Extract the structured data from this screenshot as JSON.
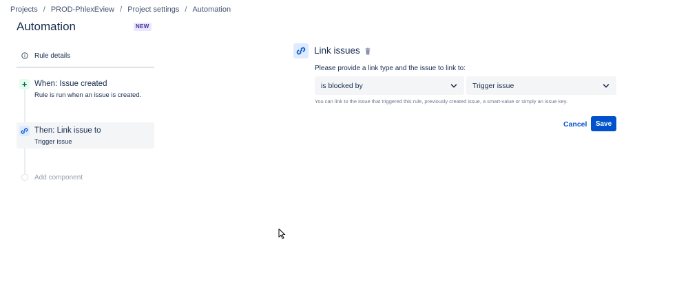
{
  "breadcrumb": {
    "items": [
      "Projects",
      "PROD-PhlexEview",
      "Project settings",
      "Automation"
    ],
    "separator": "/"
  },
  "page": {
    "title": "Automation",
    "badge": "NEW"
  },
  "rail": {
    "rule_details": {
      "label": "Rule details",
      "icon": "info-icon"
    },
    "steps": [
      {
        "title": "When: Issue created",
        "subtitle": "Rule is run when an issue is created.",
        "icon": "plus-icon",
        "color": "#006644"
      },
      {
        "title": "Then: Link issue to",
        "subtitle": "Trigger issue",
        "icon": "link-icon",
        "color": "#0052cc",
        "selected": true
      }
    ],
    "add_component": "Add component"
  },
  "panel": {
    "title": "Link issues",
    "icon": "link-icon",
    "delete_icon": "trash-icon",
    "prompt": "Please provide a link type and the issue to link to:",
    "link_type": {
      "value": "is blocked by"
    },
    "issue": {
      "value": "Trigger issue"
    },
    "helper": "You can link to the issue that triggered this rule, previously created issue, a smart-value or simply an issue key.",
    "cancel_label": "Cancel",
    "save_label": "Save"
  },
  "colors": {
    "primary": "#0052cc",
    "text": "#172b4d",
    "muted": "#6b778c",
    "field_bg": "#f4f5f7",
    "badge_bg": "#eae6ff"
  }
}
